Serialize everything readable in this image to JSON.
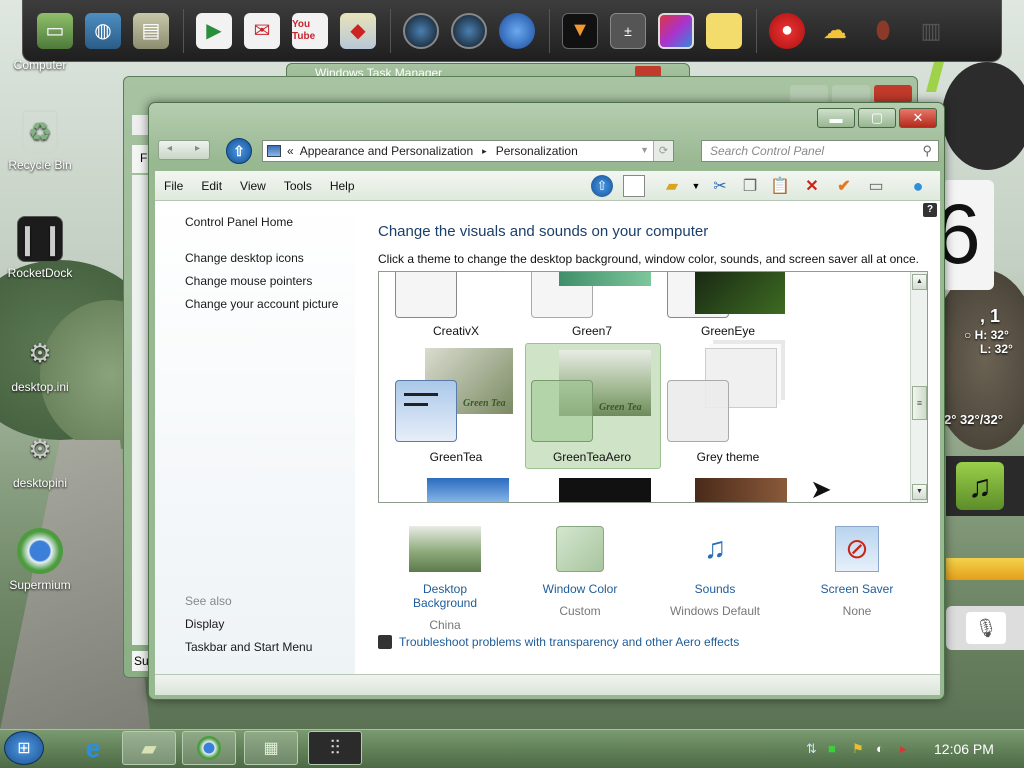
{
  "desktop": {
    "icons": [
      {
        "label": "Computer",
        "icon": "computer-icon"
      },
      {
        "label": "Recycle Bin",
        "icon": "recycle-bin-icon"
      },
      {
        "label": "RocketDock",
        "icon": "rocketdock-icon"
      },
      {
        "label": "desktop.ini",
        "icon": "gear-file-icon"
      },
      {
        "label": "desktopini",
        "icon": "gear-file-icon"
      },
      {
        "label": "Supermium",
        "icon": "browser-icon"
      }
    ]
  },
  "dock": {
    "items": [
      "computer-icon",
      "network-icon",
      "android-folder-icon",
      "play-store-icon",
      "gmail-icon",
      "youtube-icon",
      "maps-icon",
      "speaker-icon",
      "speaker-icon",
      "globe-icon",
      "color-icon",
      "calculator-icon",
      "picture-icon",
      "notes-icon",
      "angry-birds-icon",
      "weather-icon",
      "android-icon",
      "trash-icon"
    ],
    "youtube_label": "You Tube"
  },
  "widgets": {
    "clock_digit": "6",
    "weather_line1": ", 1",
    "weather_hi": "H: 32°",
    "weather_lo": "L: 32°",
    "temps": "2°  32°/32°"
  },
  "back_window": {
    "title": "Windows Task Manager",
    "menu_fi": "Fi",
    "status_sup": "Sup"
  },
  "window": {
    "address_root_icon": "control-panel-icon",
    "breadcrumb_sep": "«",
    "breadcrumb": [
      "Appearance and Personalization",
      "Personalization"
    ],
    "search_placeholder": "Search Control Panel",
    "menu": [
      "File",
      "Edit",
      "View",
      "Tools",
      "Help"
    ],
    "left_links": [
      "Control Panel Home",
      "Change desktop icons",
      "Change mouse pointers",
      "Change your account picture"
    ],
    "see_also_title": "See also",
    "see_also": [
      "Display",
      "Taskbar and Start Menu"
    ],
    "heading": "Change the visuals and sounds on your computer",
    "description": "Click a theme to change the desktop background, window color, sounds, and screen saver all at once.",
    "themes_row1": [
      "CreativX",
      "Green7",
      "GreenEye"
    ],
    "themes_row2": [
      "GreenTea",
      "GreenTeaAero",
      "Grey theme"
    ],
    "selected_theme": "GreenTeaAero",
    "thumb_caption": "Green Tea",
    "settings": [
      {
        "label": "Desktop Background",
        "value": "China"
      },
      {
        "label": "Window Color",
        "value": "Custom"
      },
      {
        "label": "Sounds",
        "value": "Windows Default"
      },
      {
        "label": "Screen Saver",
        "value": "None"
      }
    ],
    "troubleshoot": "Troubleshoot problems with transparency and other Aero effects",
    "help": "?"
  },
  "taskbar": {
    "time": "12:06 PM"
  },
  "colors": {
    "accent_green": "#98b891",
    "link_blue": "#1f5c99"
  }
}
